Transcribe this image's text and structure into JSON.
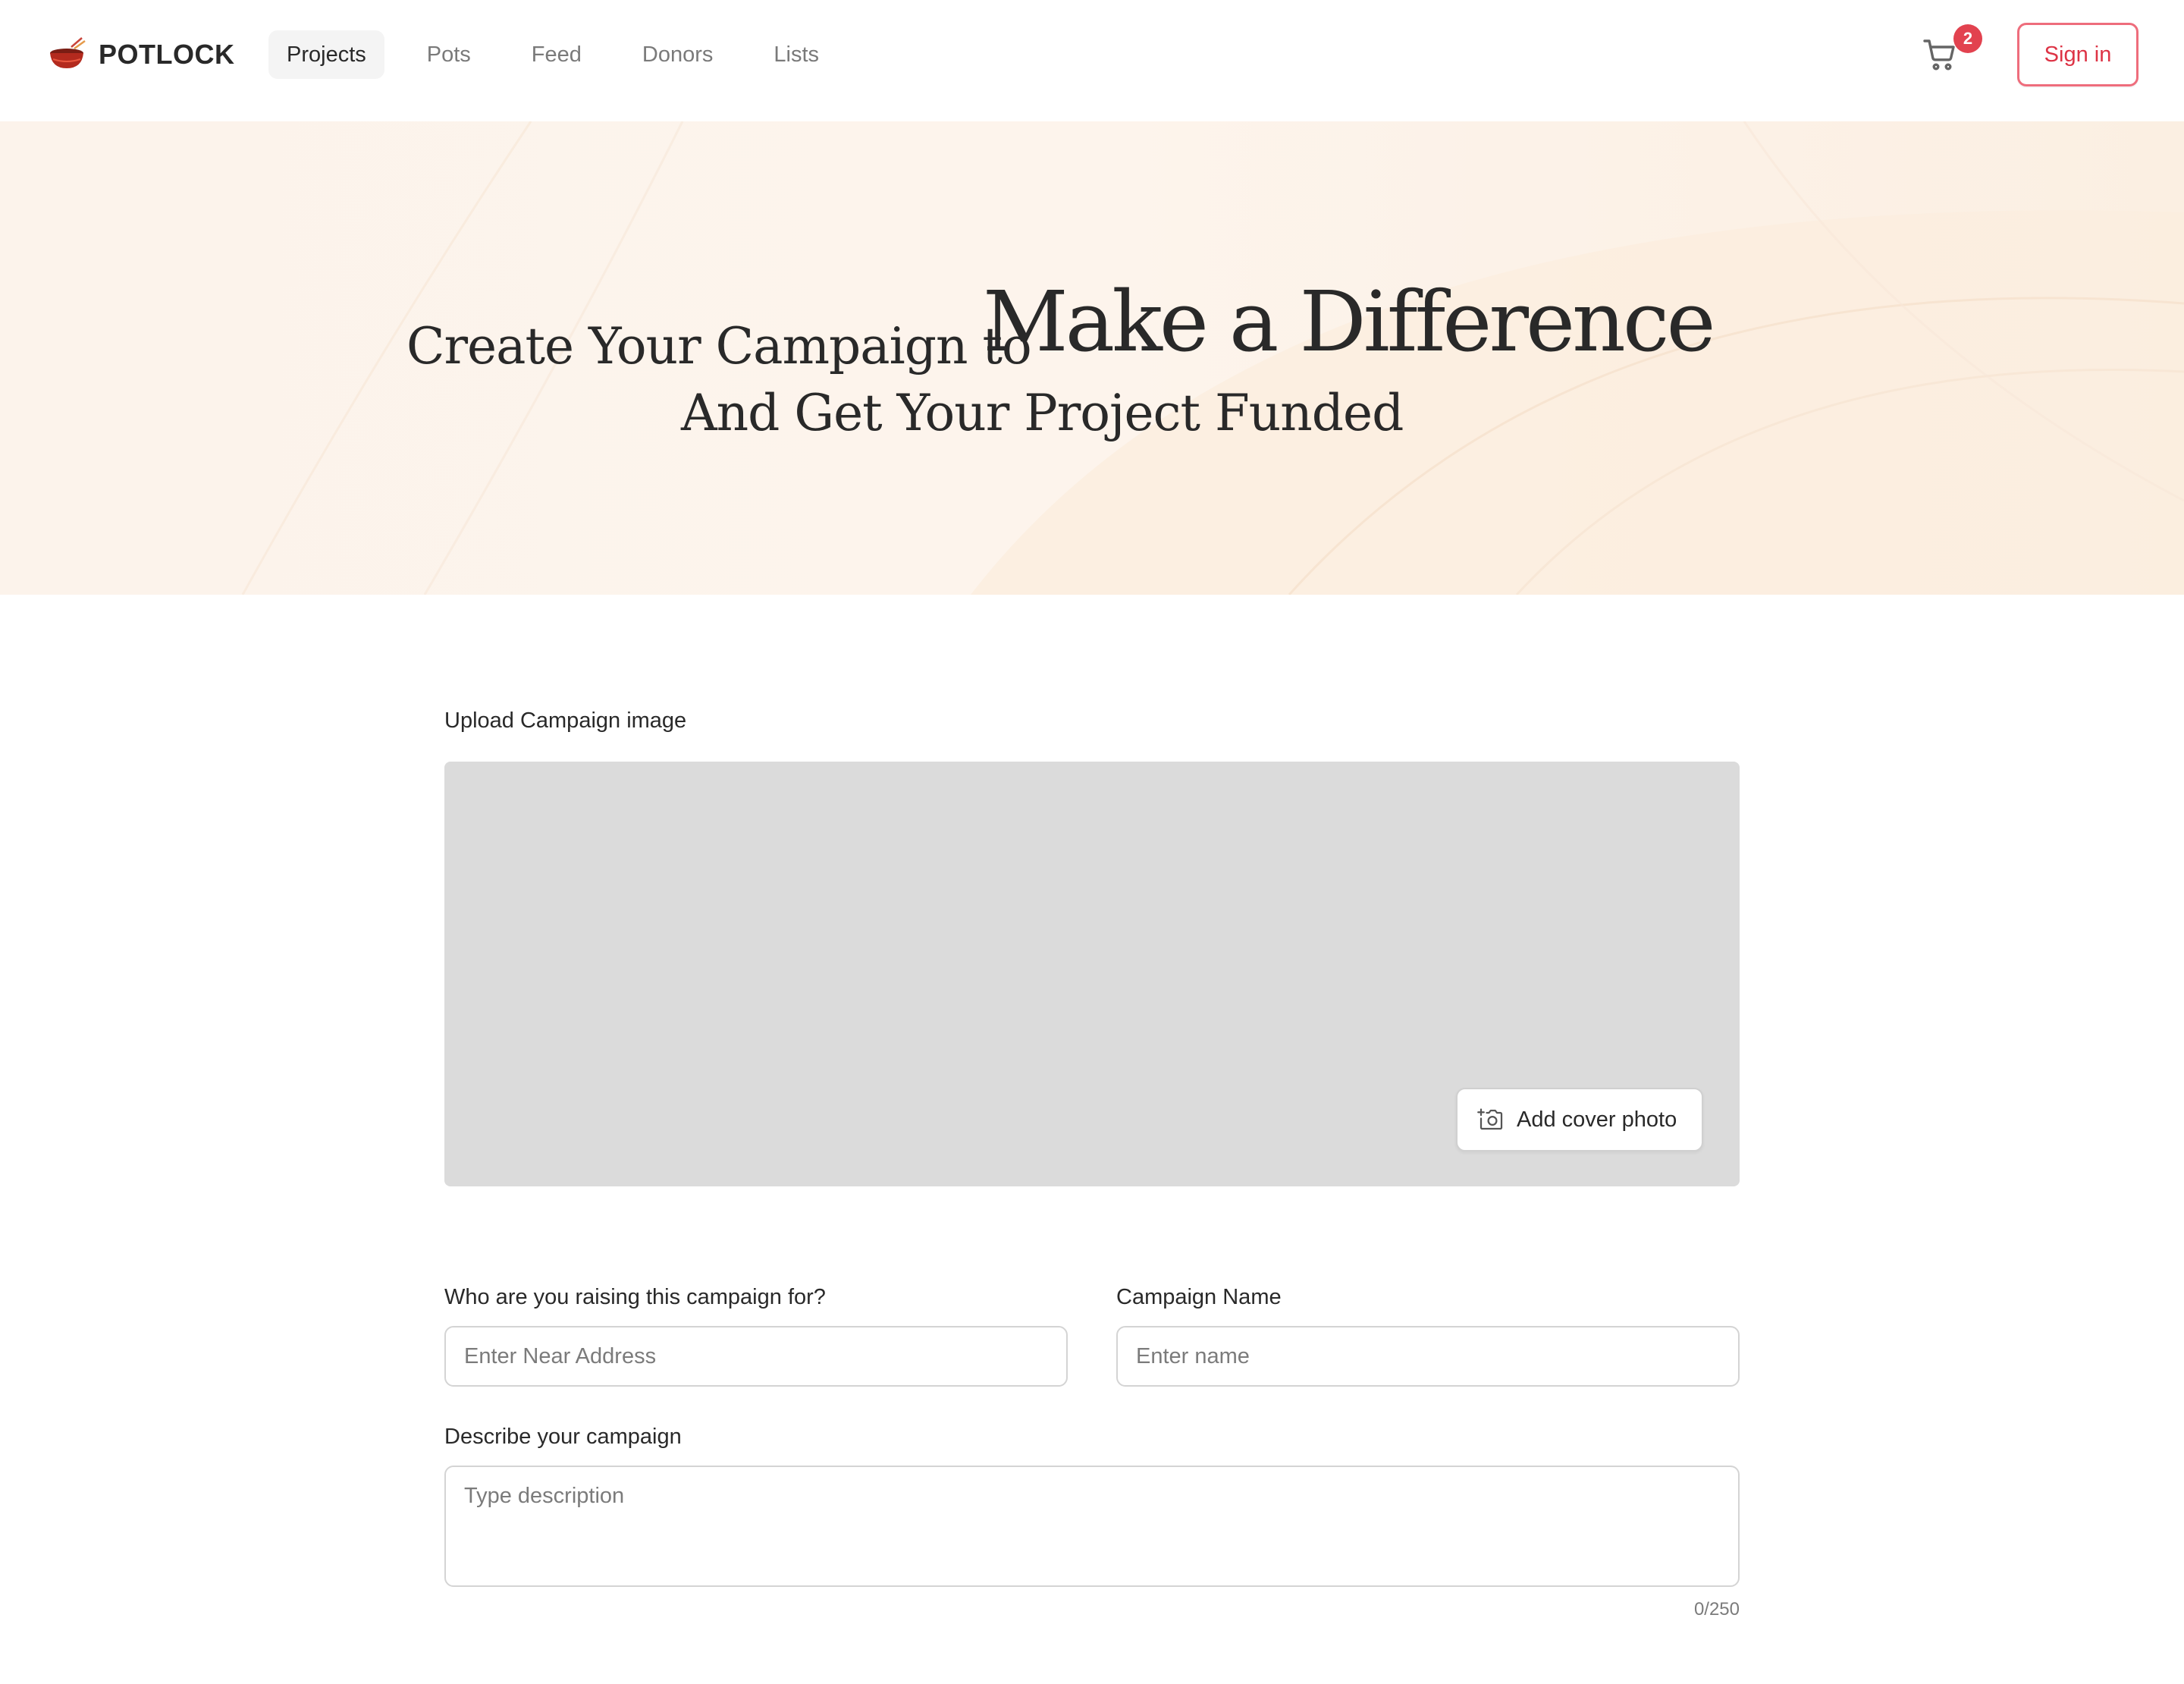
{
  "header": {
    "logo_text": "POTLOCK",
    "nav": [
      {
        "label": "Projects",
        "active": true
      },
      {
        "label": "Pots",
        "active": false
      },
      {
        "label": "Feed",
        "active": false
      },
      {
        "label": "Donors",
        "active": false
      },
      {
        "label": "Lists",
        "active": false
      }
    ],
    "cart_icon": "shopping-cart-icon",
    "cart_count": "2",
    "sign_in_label": "Sign in"
  },
  "hero": {
    "line1_prefix": "Create Your Campaign to",
    "line1_emphasis": "Make a Difference",
    "line2": "And Get Your Project Funded"
  },
  "form": {
    "upload_label": "Upload Campaign image",
    "add_cover_label": "Add cover photo",
    "add_cover_icon": "add-photo-icon",
    "recipient_label": "Who are you raising this campaign for?",
    "recipient_placeholder": "Enter Near Address",
    "name_label": "Campaign Name",
    "name_placeholder": "Enter name",
    "description_label": "Describe your campaign",
    "description_placeholder": "Type description",
    "description_counter": "0/250"
  },
  "colors": {
    "accent": "#dd3345",
    "hero_bg": "#fcf0e4",
    "cover_placeholder": "#dbdbdb"
  }
}
